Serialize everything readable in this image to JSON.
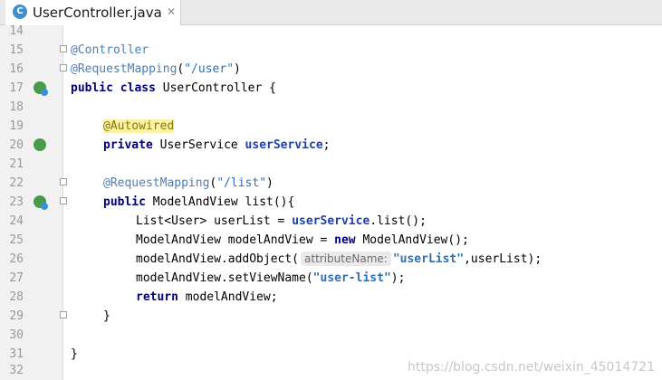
{
  "tab": {
    "icon_letter": "C",
    "file_name": "UserController.java",
    "close_glyph": "✕"
  },
  "lines": [
    {
      "n": "14"
    },
    {
      "n": "15"
    },
    {
      "n": "16"
    },
    {
      "n": "17"
    },
    {
      "n": "18"
    },
    {
      "n": "19"
    },
    {
      "n": "20"
    },
    {
      "n": "21"
    },
    {
      "n": "22"
    },
    {
      "n": "23"
    },
    {
      "n": "24"
    },
    {
      "n": "25"
    },
    {
      "n": "26"
    },
    {
      "n": "27"
    },
    {
      "n": "28"
    },
    {
      "n": "29"
    },
    {
      "n": "30"
    },
    {
      "n": "31"
    },
    {
      "n": "32"
    }
  ],
  "code": {
    "l15_ann": "@Controller",
    "l16_ann": "@RequestMapping",
    "l16_str": "\"/user\"",
    "l17_kw1": "public",
    "l17_kw2": "class",
    "l17_rest": " UserController {",
    "l19_ann": "@Autowired",
    "l20_kw": "private",
    "l20_type": " UserService ",
    "l20_field": "userService",
    "l20_end": ";",
    "l22_ann": "@RequestMapping",
    "l22_str": "\"/list\"",
    "l23_kw": "public",
    "l23_rest": " ModelAndView list(){",
    "l24_a": "List<User> userList = ",
    "l24_field": "userService",
    "l24_b": ".list();",
    "l25_a": "ModelAndView modelAndView = ",
    "l25_kw": "new",
    "l25_b": " ModelAndView();",
    "l26_a": "modelAndView.addObject(",
    "l26_hint": "attributeName:",
    "l26_str": "\"userList\"",
    "l26_b": ",userList);",
    "l27_a": "modelAndView.setViewName(",
    "l27_str": "\"user-list\"",
    "l27_b": ");",
    "l28_kw": "return",
    "l28_b": " modelAndView;",
    "l29": "}",
    "l31": "}"
  },
  "watermark": "https://blog.csdn.net/weixin_45014721",
  "gutter_icons": [
    "spring-bean-icon",
    "autowired-icon",
    "request-mapping-icon"
  ]
}
